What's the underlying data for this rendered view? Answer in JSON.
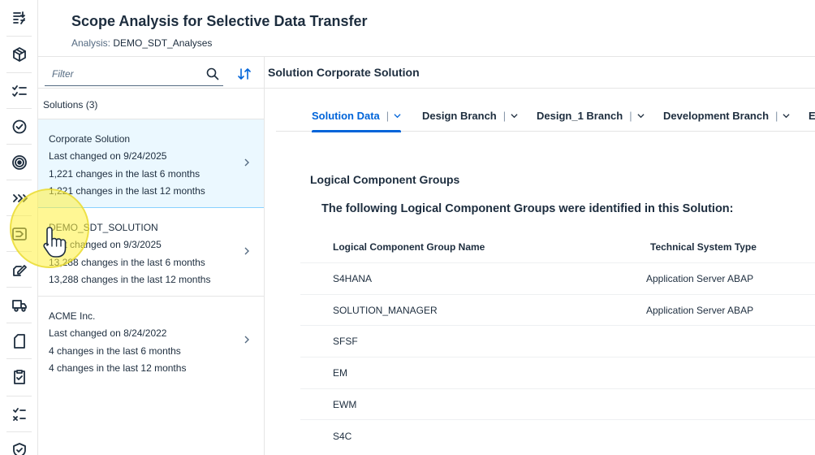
{
  "header": {
    "title": "Scope Analysis for Selective Data Transfer",
    "subtitle_label": "Analysis:",
    "subtitle_value": "DEMO_SDT_Analyses"
  },
  "rail": {
    "icons": [
      "list-filter-icon",
      "cube-icon",
      "checklist-icon",
      "badge-check-icon",
      "target-icon",
      "expand-icon",
      "monitor-play-icon",
      "edit-icon",
      "truck-icon",
      "document-icon",
      "clipboard-check-icon",
      "task-list-icon",
      "shield-check-icon"
    ]
  },
  "master": {
    "filter_placeholder": "Filter",
    "list_header": "Solutions (3)",
    "items": [
      {
        "name": "Corporate Solution",
        "changed": "Last changed on 9/24/2025",
        "six_months": "1,221 changes in the last 6 months",
        "twelve_months": "1,221 changes in the last 12 months"
      },
      {
        "name": "DEMO_SDT_SOLUTION",
        "changed": "Last changed on 9/3/2025",
        "six_months": "13,288 changes in the last 6 months",
        "twelve_months": "13,288 changes in the last 12 months"
      },
      {
        "name": "ACME Inc.",
        "changed": "Last changed on 8/24/2022",
        "six_months": "4 changes in the last 6 months",
        "twelve_months": "4 changes in the last 12 months"
      }
    ]
  },
  "detail": {
    "title": "Solution Corporate Solution",
    "tabs": [
      {
        "label": "Solution Data",
        "active": true
      },
      {
        "label": "Design Branch",
        "active": false
      },
      {
        "label": "Design_1 Branch",
        "active": false
      },
      {
        "label": "Development Branch",
        "active": false
      },
      {
        "label": "E",
        "active": false
      }
    ],
    "section_title": "Logical Component Groups",
    "section_sub": "The following Logical Component Groups were identified in this Solution:",
    "table": {
      "columns": [
        "Logical Component Group Name",
        "Technical System Type"
      ],
      "rows": [
        [
          "S4HANA",
          "Application Server ABAP"
        ],
        [
          "SOLUTION_MANAGER",
          "Application Server ABAP"
        ],
        [
          "SFSF",
          ""
        ],
        [
          "EM",
          ""
        ],
        [
          "EWM",
          ""
        ],
        [
          "S4C",
          ""
        ]
      ]
    }
  },
  "colors": {
    "accent": "#0064d9",
    "selected_bg": "#ebf8ff",
    "text": "#1d2d3e",
    "highlight": "#fff03c"
  }
}
